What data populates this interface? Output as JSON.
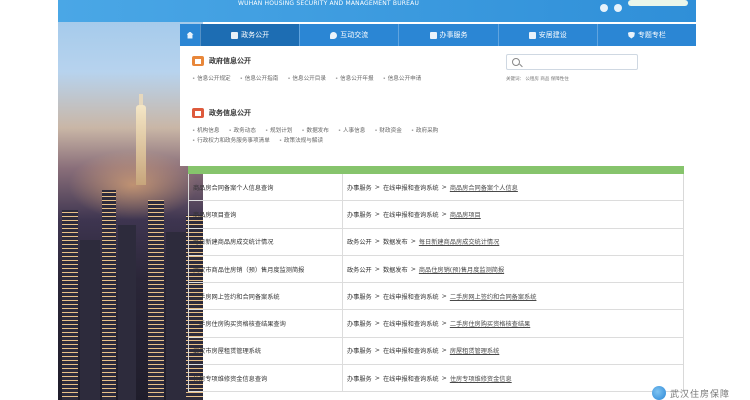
{
  "header": {
    "title": "WUHAN HOUSING SECURITY AND MANAGEMENT BUREAU"
  },
  "nav": {
    "items": [
      {
        "label": "政务公开",
        "icon": "document-icon",
        "active": true
      },
      {
        "label": "互动交流",
        "icon": "chat-icon",
        "active": false
      },
      {
        "label": "办事服务",
        "icon": "service-icon",
        "active": false
      },
      {
        "label": "安居建设",
        "icon": "building-icon",
        "active": false
      },
      {
        "label": "专题专栏",
        "icon": "shield-icon",
        "active": false
      }
    ]
  },
  "gov_info": {
    "title": "政府信息公开",
    "links": [
      "信息公开规定",
      "信息公开指南",
      "信息公开目录",
      "信息公开年报",
      "信息公开申请"
    ]
  },
  "affairs": {
    "title": "政务信息公开",
    "links": [
      "机构信息",
      "政务动态",
      "规划计划",
      "数据发布",
      "人事信息",
      "财政资金",
      "政府采购",
      "行政权力和政务服务事项清单",
      "政策法规与解读"
    ]
  },
  "search": {
    "hot_words": "关键词： 公租房  商品  保障性住"
  },
  "table": {
    "rows": [
      {
        "name": "商品房合同备案个人信息查询",
        "path": [
          "办事服务",
          "在线申报和查询系统"
        ],
        "link": "商品房合同备案个人信息"
      },
      {
        "name": "商品房项目查询",
        "path": [
          "办事服务",
          "在线申报和查询系统"
        ],
        "link": "商品房项目"
      },
      {
        "name": "每日新建商品房成交统计情况",
        "path": [
          "政务公开",
          "数据发布"
        ],
        "link": "每日新建商品房成交统计情况"
      },
      {
        "name": "武汉市商品住房销（预）售月度监测简报",
        "path": [
          "政务公开",
          "数据发布"
        ],
        "link": "商品住房销(预)售月度监测简报"
      },
      {
        "name": "二手房网上签约和合同备案系统",
        "path": [
          "办事服务",
          "在线申报和查询系统"
        ],
        "link": "二手房网上签约和合同备案系统"
      },
      {
        "name": "二手房住房购买资格核查结果查询",
        "path": [
          "办事服务",
          "在线申报和查询系统"
        ],
        "link": "二手房住房购买资格核查结果"
      },
      {
        "name": "武汉市房屋租赁管理系统",
        "path": [
          "办事服务",
          "在线申报和查询系统"
        ],
        "link": "房屋租赁管理系统"
      },
      {
        "name": "住房专项维修资金信息查询",
        "path": [
          "办事服务",
          "在线申报和查询系统"
        ],
        "link": "住房专项维修资金信息"
      }
    ]
  },
  "watermark": {
    "text": "武汉住房保障"
  }
}
